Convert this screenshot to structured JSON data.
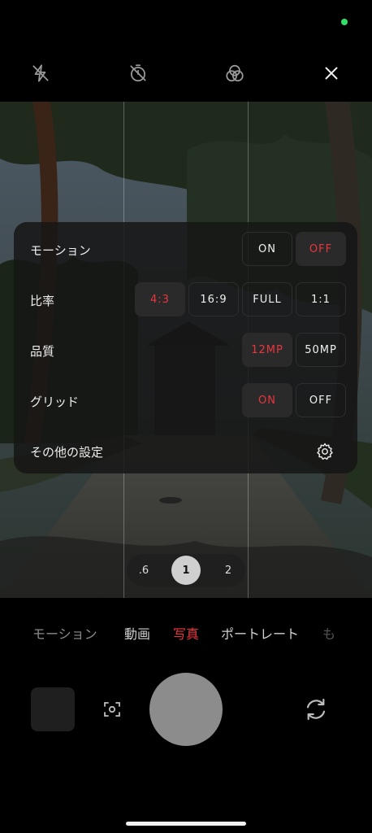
{
  "status": {
    "indicator_color": "#2ee06a"
  },
  "topbar": {
    "icons": [
      "flash-off-icon",
      "timer-off-icon",
      "filter-icon",
      "close-icon"
    ]
  },
  "settings": {
    "motion": {
      "label": "モーション",
      "options": [
        "ON",
        "OFF"
      ],
      "selected": "OFF"
    },
    "ratio": {
      "label": "比率",
      "options": [
        "4:3",
        "16:9",
        "FULL",
        "1:1"
      ],
      "selected": "4:3"
    },
    "quality": {
      "label": "品質",
      "options": [
        "12MP",
        "50MP"
      ],
      "selected": "12MP"
    },
    "grid": {
      "label": "グリッド",
      "options": [
        "ON",
        "OFF"
      ],
      "selected": "ON"
    },
    "more": {
      "label": "その他の設定",
      "icon": "gear-icon"
    }
  },
  "zoom": {
    "options": [
      ".6",
      "1",
      "2"
    ],
    "selected": "1"
  },
  "modes": {
    "items": [
      "モーション",
      "動画",
      "写真",
      "ポートレート",
      "も"
    ],
    "selected": "写真"
  },
  "colors": {
    "accent": "#e8363f",
    "panel": "#161616"
  }
}
